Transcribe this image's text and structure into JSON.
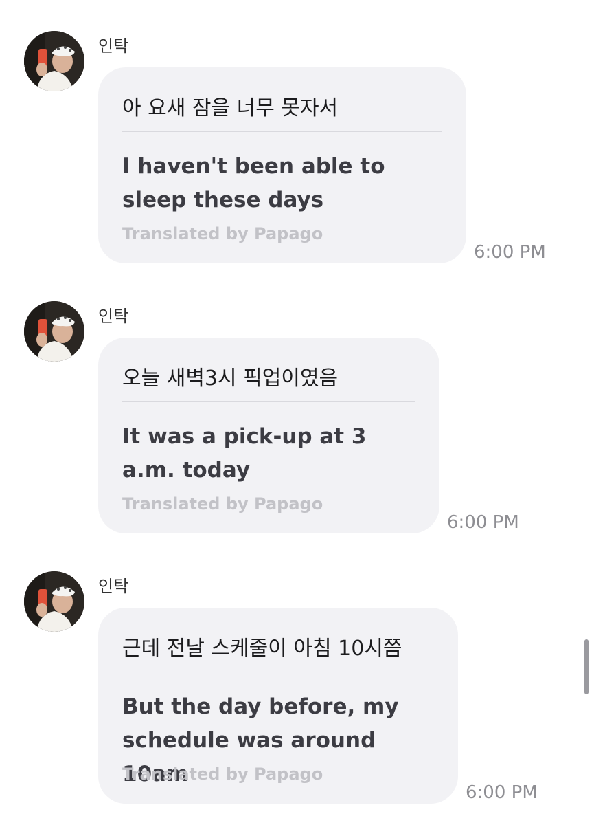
{
  "messages": [
    {
      "sender": "인탁",
      "original": "아 요새 잠을 너무 못자서",
      "translation": "I haven't been able to sleep these days",
      "credit": "Translated by Papago",
      "time": "6:00 PM"
    },
    {
      "sender": "인탁",
      "original": "오늘 새벽3시 픽업이였음",
      "translation": "It was a pick-up at 3 a.m. today",
      "credit": "Translated by Papago",
      "time": "6:00 PM"
    },
    {
      "sender": "인탁",
      "original": "근데 전날 스케줄이 아침 10시쯤",
      "translation": "But the day before, my schedule was around 10am",
      "credit": "Translated by Papago",
      "time": "6:00 PM"
    }
  ],
  "colors": {
    "bubble": "#f2f2f5",
    "timestamp": "#8e8e93",
    "credit": "#c2c2c7"
  }
}
